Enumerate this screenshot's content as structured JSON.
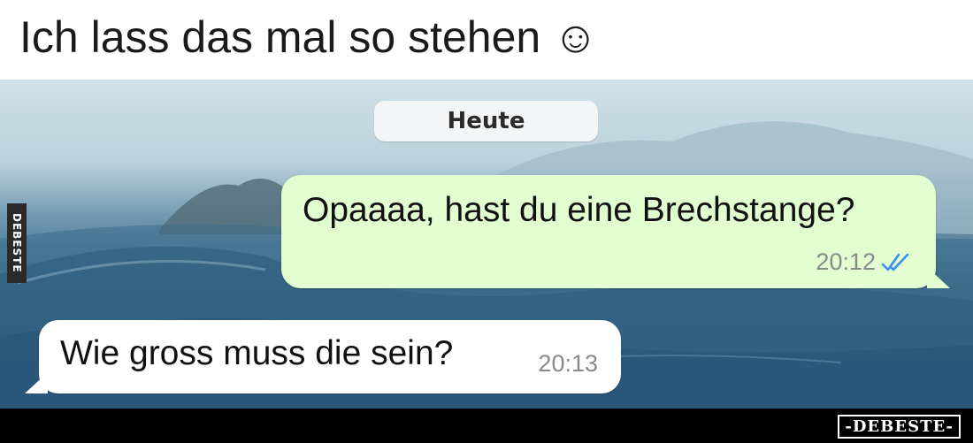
{
  "headline": {
    "text": "Ich lass das mal so stehen ☺"
  },
  "chat": {
    "date_label": "Heute",
    "messages": [
      {
        "direction": "outgoing",
        "text": "Opaaaa, hast du eine Brechstange?",
        "time": "20:12",
        "status_icon": "double-check-read-icon"
      },
      {
        "direction": "incoming",
        "text": "Wie gross muss die sein?",
        "time": "20:13"
      }
    ]
  },
  "watermark": {
    "side_text": "DEBESTE",
    "footer_text": "-DEBESTE-"
  },
  "colors": {
    "outgoing_bubble": "#e2fdcf",
    "incoming_bubble": "#ffffff",
    "read_check": "#3b8ff0",
    "timestamp": "#8a8a8a"
  }
}
